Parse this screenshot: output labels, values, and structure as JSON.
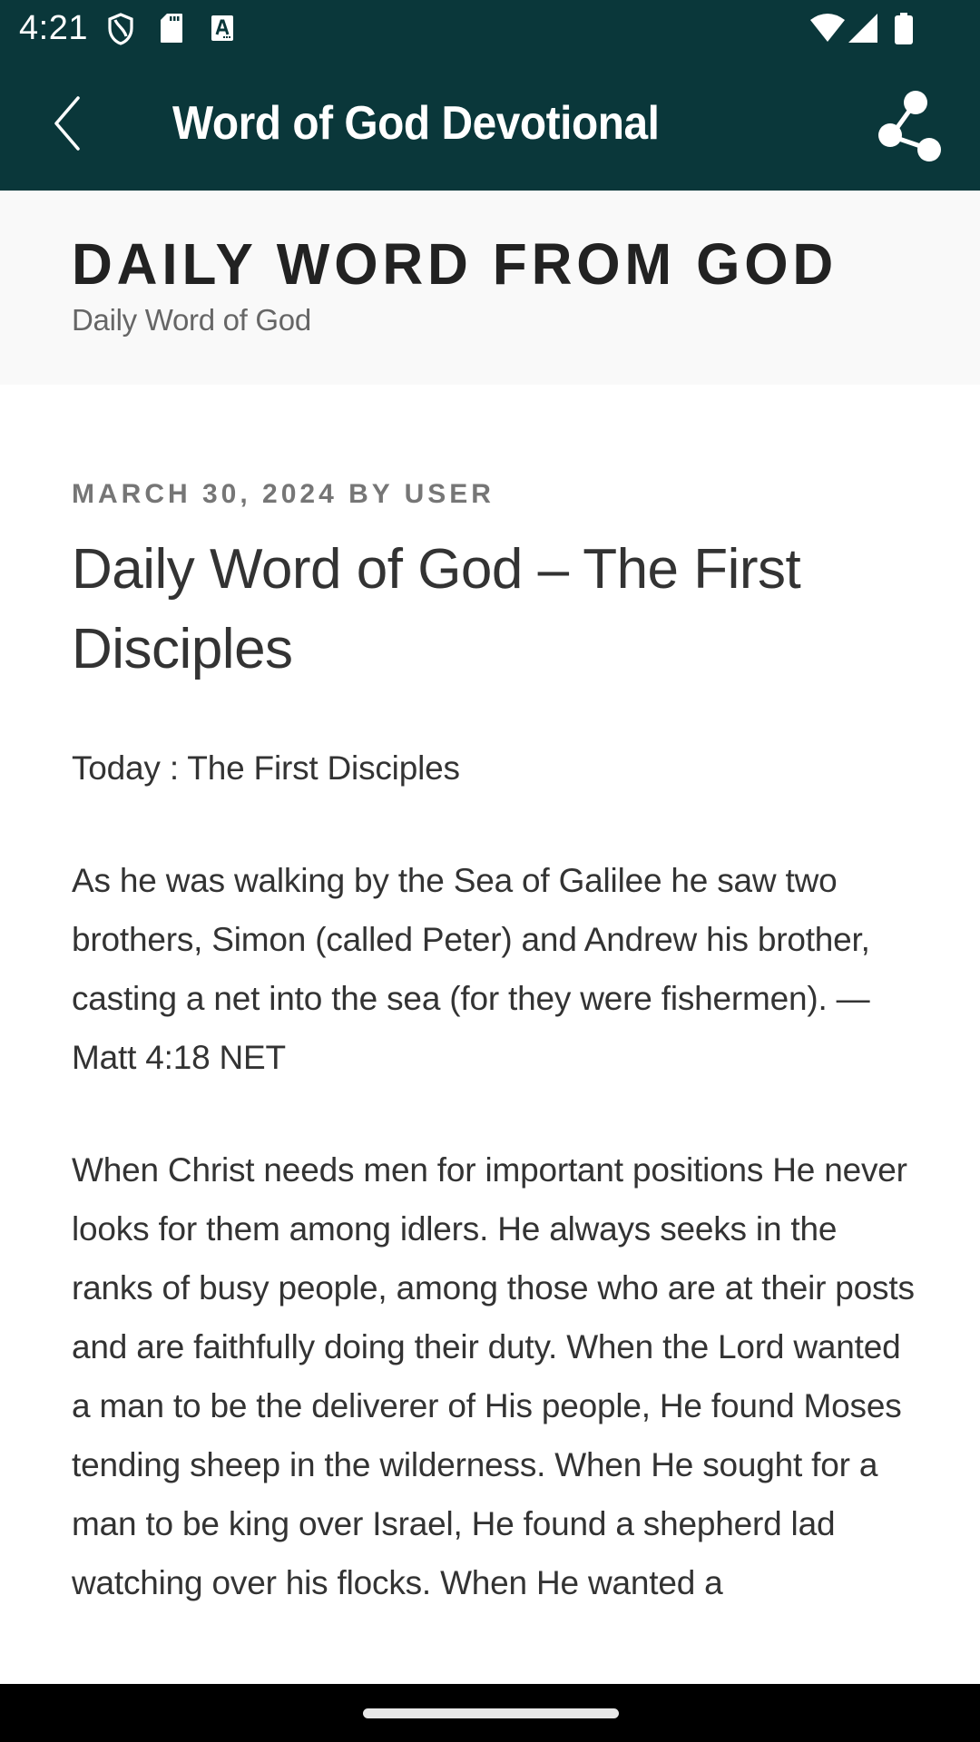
{
  "status_bar": {
    "time": "4:21",
    "left_icons": [
      "shield-icon",
      "sd-card-icon",
      "font-a-icon"
    ],
    "right_icons": [
      "wifi-icon",
      "cell-signal-icon",
      "battery-icon"
    ]
  },
  "toolbar": {
    "back_icon": "chevron-left-icon",
    "title": "Word of God Devotional",
    "share_icon": "share-icon"
  },
  "site_header": {
    "title": "DAILY WORD FROM GOD",
    "tagline": "Daily Word of God"
  },
  "post": {
    "date": "MARCH 30, 2024",
    "by_label": "BY",
    "author": "USER",
    "title": "Daily Word of God – The First Disciples",
    "paragraphs": [
      "Today : The First Disciples",
      "As he was walking by the Sea of Galilee he saw two brothers, Simon (called Peter) and Andrew his brother, casting a net into the sea (for they were fishermen). — Matt 4:18 NET",
      "When Christ needs men for important positions He never looks for them among idlers. He always seeks in the ranks of busy people, among those who are at their posts and are faithfully doing their duty. When the Lord wanted a man to be the deliverer of His people, He found Moses tending sheep in the wilderness. When He sought for a man to be king over Israel, He found a shepherd lad watching over his flocks. When He wanted a"
    ]
  },
  "colors": {
    "appbar": "#0a373a",
    "header_band": "#f9f9f9",
    "body_text": "#333333",
    "meta_text": "#767676",
    "navbar": "#000000"
  }
}
